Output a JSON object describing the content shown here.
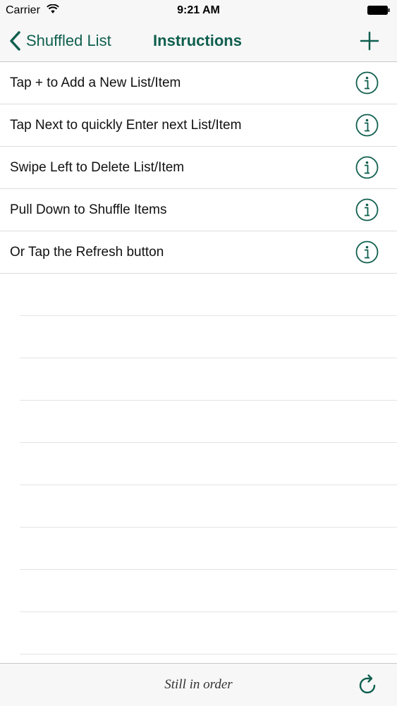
{
  "status_bar": {
    "carrier": "Carrier",
    "time": "9:21 AM",
    "icons": [
      "wifi-icon",
      "battery-icon"
    ]
  },
  "nav_bar": {
    "back_label": "Shuffled List",
    "title": "Instructions",
    "back_icon": "chevron-left-icon",
    "add_icon": "plus-icon"
  },
  "list": {
    "items": [
      {
        "label": "Tap + to Add a New List/Item",
        "icon": "info-icon"
      },
      {
        "label": "Tap Next to quickly Enter next List/Item",
        "icon": "info-icon"
      },
      {
        "label": "Swipe Left to Delete List/Item",
        "icon": "info-icon"
      },
      {
        "label": "Pull Down to Shuffle Items",
        "icon": "info-icon"
      },
      {
        "label": "Or Tap the Refresh button",
        "icon": "info-icon"
      }
    ]
  },
  "toolbar": {
    "status_text": "Still in order",
    "refresh_icon": "refresh-icon"
  },
  "colors": {
    "accent": "#0f5f4e",
    "bar_background": "#f7f7f7",
    "separator": "#dcdcdc"
  }
}
